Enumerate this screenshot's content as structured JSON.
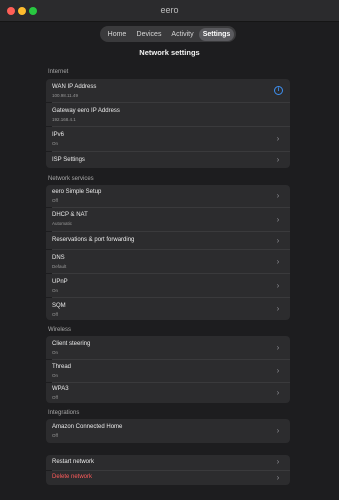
{
  "window": {
    "title": "eero"
  },
  "tabs": [
    {
      "label": "Home"
    },
    {
      "label": "Devices"
    },
    {
      "label": "Activity"
    },
    {
      "label": "Settings"
    }
  ],
  "page": {
    "title": "Network settings"
  },
  "sections": {
    "internet": {
      "label": "Internet",
      "items": [
        {
          "label": "WAN IP Address",
          "value": "100.98.11.49"
        },
        {
          "label": "Gateway eero IP Address",
          "value": "192.168.4.1"
        },
        {
          "label": "IPv6",
          "value": "On"
        },
        {
          "label": "ISP Settings"
        }
      ]
    },
    "network_services": {
      "label": "Network services",
      "items": [
        {
          "label": "eero Simple Setup",
          "value": "Off"
        },
        {
          "label": "DHCP & NAT",
          "value": "Automatic"
        },
        {
          "label": "Reservations & port forwarding"
        },
        {
          "label": "DNS",
          "value": "Default"
        },
        {
          "label": "UPnP",
          "value": "On"
        },
        {
          "label": "SQM",
          "value": "Off"
        }
      ]
    },
    "wireless": {
      "label": "Wireless",
      "items": [
        {
          "label": "Client steering",
          "value": "On"
        },
        {
          "label": "Thread",
          "value": "On"
        },
        {
          "label": "WPA3",
          "value": "Off"
        }
      ]
    },
    "integrations": {
      "label": "Integrations",
      "items": [
        {
          "label": "Amazon Connected Home",
          "value": "Off"
        }
      ]
    }
  },
  "actions": {
    "restart_label": "Restart network",
    "delete_label": "Delete network"
  },
  "colors": {
    "accent_blue": "#3d8ff0",
    "danger_red": "#ff5b5b"
  },
  "icons": {
    "info": "info-icon",
    "chevron": "chevron-right-icon"
  }
}
